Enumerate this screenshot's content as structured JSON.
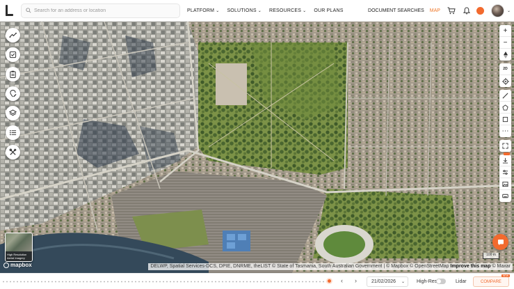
{
  "search": {
    "placeholder": "Search for an address or location"
  },
  "nav": {
    "items": [
      {
        "label": "PLATFORM",
        "has_dropdown": true
      },
      {
        "label": "SOLUTIONS",
        "has_dropdown": true
      },
      {
        "label": "RESOURCES",
        "has_dropdown": true
      },
      {
        "label": "OUR PLANS",
        "has_dropdown": false
      }
    ],
    "document_searches": "DOCUMENT SEARCHES",
    "map": "MAP"
  },
  "icons": {
    "cart": "cart-icon",
    "bell": "bell-icon"
  },
  "colors": {
    "accent": "#f26a2e",
    "map_link": "#f0792b"
  },
  "left_tools": [
    {
      "name": "measure-tool-icon"
    },
    {
      "name": "checklist-icon"
    },
    {
      "name": "clipboard-icon"
    },
    {
      "name": "pin-edit-icon"
    },
    {
      "name": "layers-icon"
    },
    {
      "name": "list-icon"
    },
    {
      "name": "tools-icon"
    }
  ],
  "right_tools": {
    "view_mode": "2D"
  },
  "minimap": {
    "label": "High Resolution Aerial Imagery"
  },
  "mapbox": {
    "label": "mapbox"
  },
  "attribution": {
    "text": "DELWP, Spatial Services-DCS, DPIE, DNRME, theLIST © State of Tasmania, South Australian Government | © Mapbox © OpenStreetMap",
    "improve": "Improve this map",
    "suffix": "© Maxar"
  },
  "scale": {
    "label": "100 m"
  },
  "bottom": {
    "date": "21/02/2026",
    "hires_label": "High-Res",
    "hires_enabled": false,
    "lidar_label": "Lidar",
    "compare_label": "COMPARE",
    "compare_badge": "NEW"
  }
}
